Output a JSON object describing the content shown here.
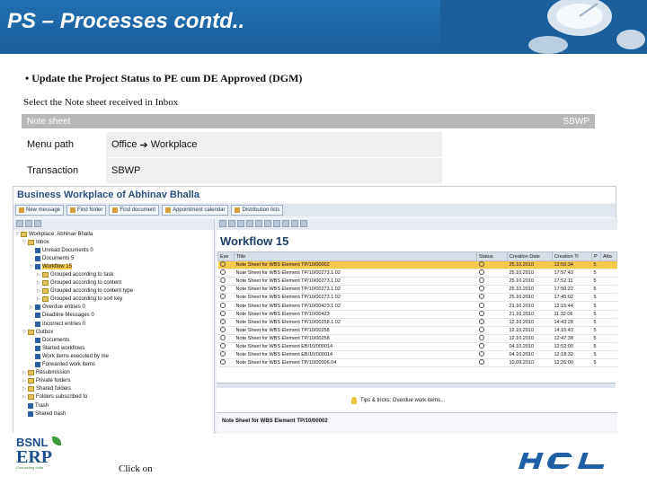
{
  "slide": {
    "title": "PS – Processes  contd..",
    "bullet": "• Update the Project Status to PE cum DE Approved (DGM)",
    "subnote": "Select the Note sheet received in Inbox",
    "click_on": "Click on"
  },
  "nav": {
    "header_left": "Note sheet",
    "header_right": "SBWP",
    "rows": [
      {
        "key": "Menu path",
        "value": "Office  Workplace"
      },
      {
        "key": "Transaction",
        "value": "SBWP"
      }
    ]
  },
  "sap": {
    "window_title": "Business Workplace of Abhinav Bhalla",
    "toolbar": [
      "New message",
      "Find folder",
      "Find document",
      "Appointment calendar",
      "Distribution lists"
    ],
    "tree": [
      {
        "label": "Workplace: Abhinav Bhalla",
        "indent": 0,
        "exp": "▽",
        "icon": "folder"
      },
      {
        "label": "Inbox",
        "indent": 1,
        "exp": "▽",
        "icon": "folder"
      },
      {
        "label": "Unread Documents 0",
        "indent": 2,
        "exp": "",
        "icon": "doc"
      },
      {
        "label": "Documents 5",
        "indent": 2,
        "exp": "",
        "icon": "doc"
      },
      {
        "label": "Workflow 15",
        "indent": 2,
        "exp": "▽",
        "icon": "doc",
        "selected": true
      },
      {
        "label": "Grouped according to task",
        "indent": 3,
        "exp": "▷",
        "icon": "folder"
      },
      {
        "label": "Grouped according to content",
        "indent": 3,
        "exp": "▷",
        "icon": "folder"
      },
      {
        "label": "Grouped according to content type",
        "indent": 3,
        "exp": "▷",
        "icon": "folder"
      },
      {
        "label": "Grouped according to sort key",
        "indent": 3,
        "exp": "▷",
        "icon": "folder"
      },
      {
        "label": "Overdue entries 0",
        "indent": 2,
        "exp": "▷",
        "icon": "doc"
      },
      {
        "label": "Deadline Messages 0",
        "indent": 2,
        "exp": "",
        "icon": "doc"
      },
      {
        "label": "Incorrect entries 0",
        "indent": 2,
        "exp": "",
        "icon": "doc"
      },
      {
        "label": "Outbox",
        "indent": 1,
        "exp": "▽",
        "icon": "folder"
      },
      {
        "label": "Documents",
        "indent": 2,
        "exp": "",
        "icon": "doc"
      },
      {
        "label": "Started workflows",
        "indent": 2,
        "exp": "",
        "icon": "doc"
      },
      {
        "label": "Work items executed by me",
        "indent": 2,
        "exp": "",
        "icon": "doc"
      },
      {
        "label": "Forwarded work items",
        "indent": 2,
        "exp": "",
        "icon": "doc"
      },
      {
        "label": "Resubmission",
        "indent": 1,
        "exp": "▷",
        "icon": "folder"
      },
      {
        "label": "Private folders",
        "indent": 1,
        "exp": "▷",
        "icon": "folder"
      },
      {
        "label": "Shared folders",
        "indent": 1,
        "exp": "▷",
        "icon": "folder"
      },
      {
        "label": "Folders subscribed to",
        "indent": 1,
        "exp": "▷",
        "icon": "folder"
      },
      {
        "label": "Trash",
        "indent": 1,
        "exp": "",
        "icon": "doc"
      },
      {
        "label": "Shared trash",
        "indent": 1,
        "exp": "",
        "icon": "doc"
      }
    ],
    "workflow_title": "Workflow 15",
    "columns": [
      "Exe",
      "Title",
      "Status",
      "Creation Date",
      "Creation Ti",
      "P",
      "Atta"
    ],
    "rows": [
      {
        "title": "Note Sheet for WBS Element TP/10/00002",
        "date": "25.10.2010",
        "time": "12:56:34",
        "p": "5",
        "selected": true
      },
      {
        "title": "Note Sheet for WBS Element TP/10/00273.1.02",
        "date": "25.10.2010",
        "time": "17:57:43",
        "p": "5"
      },
      {
        "title": "Note Sheet for WBS Element TP/10/00273.1.02",
        "date": "25.10.2010",
        "time": "17:52:11",
        "p": "5"
      },
      {
        "title": "Note Sheet for WBS Element TP/10/00273.1.02",
        "date": "25.10.2010",
        "time": "17:50:22",
        "p": "5"
      },
      {
        "title": "Note Sheet for WBS Element TP/10/00273.1.02",
        "date": "25.10.2010",
        "time": "17:45:02",
        "p": "5"
      },
      {
        "title": "Note Sheet for WBS Element TP/10/00423.1.02",
        "date": "21.10.2010",
        "time": "12:15:44",
        "p": "5"
      },
      {
        "title": "Note Sheet for WBS Element TP/10/00423",
        "date": "21.10.2010",
        "time": "11:32:06",
        "p": "5"
      },
      {
        "title": "Note Sheet for WBS Element TP/10/00258.1.02",
        "date": "12.10.2010",
        "time": "14:43:28",
        "p": "5"
      },
      {
        "title": "Note Sheet for WBS Element TP/10/00258",
        "date": "12.10.2010",
        "time": "14:15:43",
        "p": "5"
      },
      {
        "title": "Note Sheet for WBS Element TP/10/00258",
        "date": "12.10.2010",
        "time": "12:47:38",
        "p": "5"
      },
      {
        "title": "Note Sheet for WBS Element EB/10/000014",
        "date": "04.10.2010",
        "time": "12:52:00",
        "p": "5"
      },
      {
        "title": "Note Sheet for WBS Element EB/10/000014",
        "date": "04.10.2010",
        "time": "12:18:32",
        "p": "5"
      },
      {
        "title": "Note Sheet for WBS Element TP/10/00006.04",
        "date": "10.09.2010",
        "time": "12:26:00",
        "p": "5"
      }
    ],
    "tips": "Tips & tricks: Overdue work items...",
    "preview_title": "Note Sheet for WBS Element TP/10/00002"
  },
  "logos": {
    "bsnl": "BSNL",
    "erp": "ERP",
    "bsnl_tagline": "Connecting India",
    "hcl": "HCL"
  },
  "colors": {
    "title_bg": "#1f6fb2",
    "selection": "#f7c94a",
    "nav_header": "#b7b7b7"
  }
}
